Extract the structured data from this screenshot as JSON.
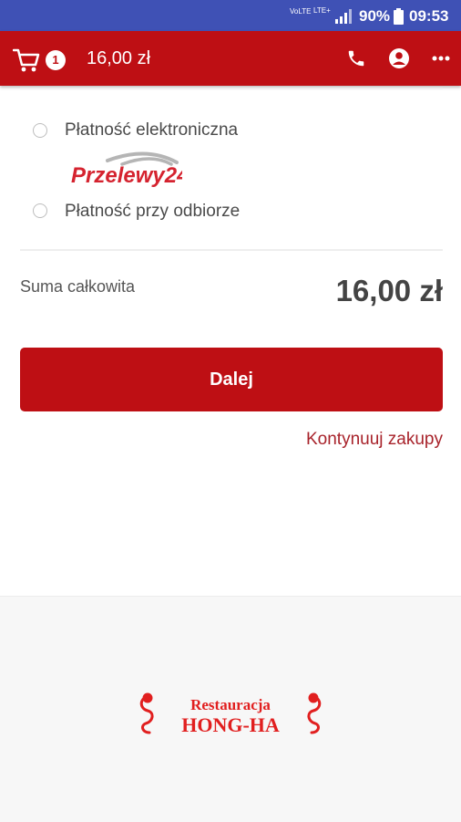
{
  "status_bar": {
    "volte": "VoLTE",
    "lte": "LTE+",
    "battery_pct": "90%",
    "time": "09:53"
  },
  "app_bar": {
    "cart_count": "1",
    "cart_total": "16,00 zł",
    "icons": [
      "cart-icon",
      "phone-icon",
      "user-icon",
      "more-icon"
    ]
  },
  "payment": {
    "options": [
      {
        "label": "Płatność elektroniczna",
        "logo_text": "Przelewy24",
        "selected": false
      },
      {
        "label": "Płatność przy odbiorze",
        "selected": false
      }
    ]
  },
  "summary": {
    "label": "Suma całkowita",
    "value": "16,00 zł"
  },
  "actions": {
    "next": "Dalej",
    "continue_shopping": "Kontynuuj zakupy"
  },
  "footer": {
    "logo_line1": "Restauracja",
    "logo_line2": "HONG-HA"
  },
  "colors": {
    "status_bar": "#3F51B5",
    "brand_red": "#BE0F14",
    "link_red": "#A8232B"
  }
}
